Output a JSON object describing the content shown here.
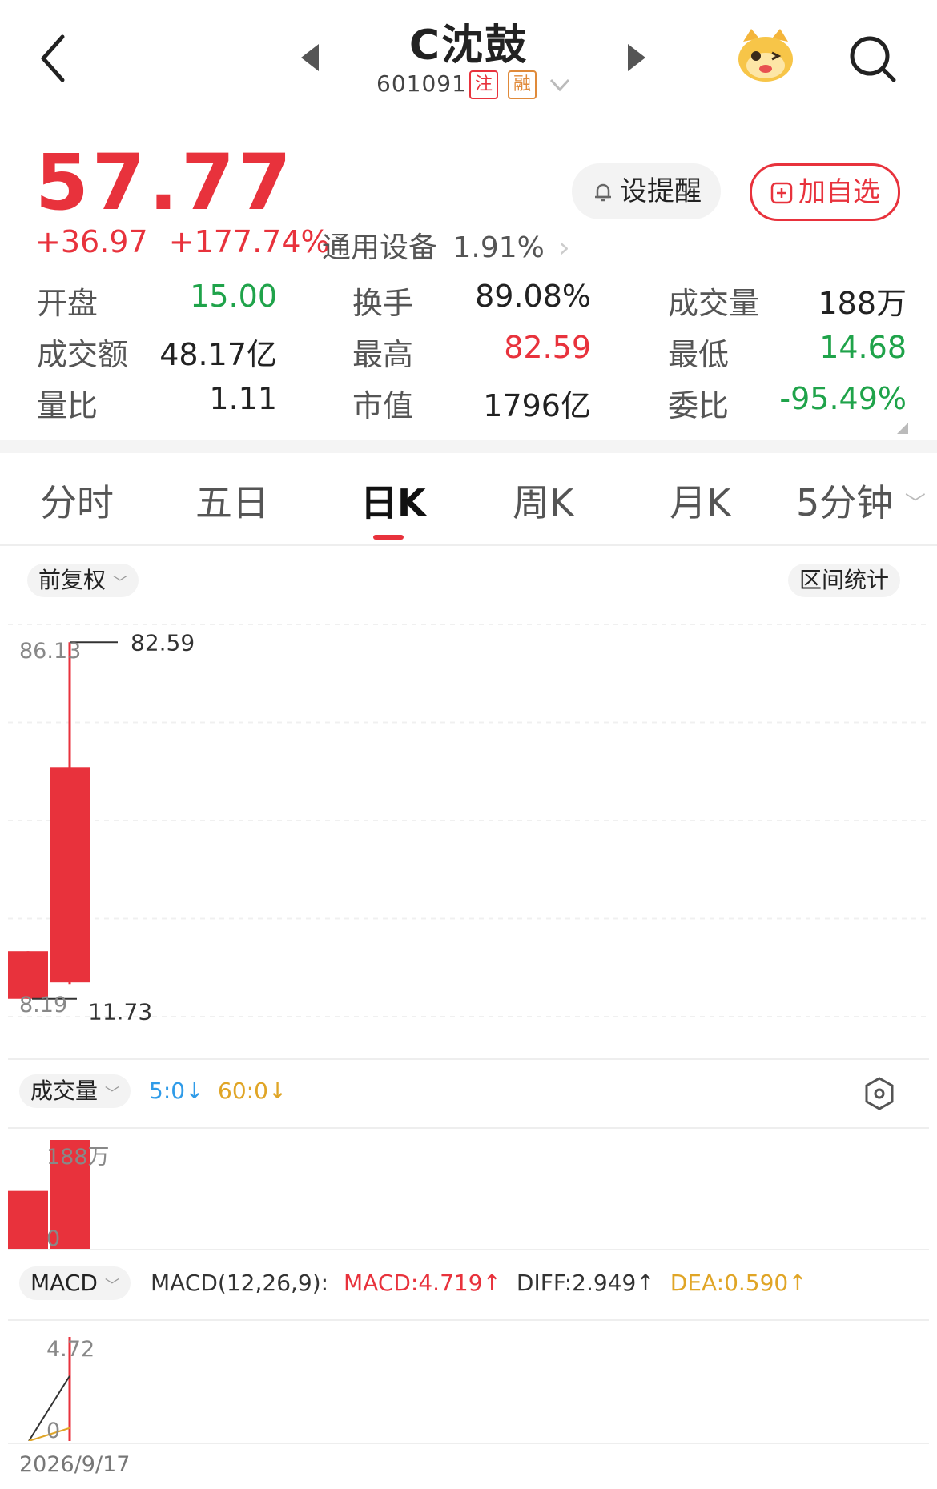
{
  "header": {
    "title": "C沈鼓",
    "code": "601091",
    "tag_margin": "注",
    "tag_finance": "融"
  },
  "quote": {
    "price": "57.77",
    "change": "+36.97",
    "change_pct": "+177.74%",
    "industry": "通用设备",
    "industry_pct": "1.91%",
    "alert_label": "设提醒",
    "add_label": "加自选"
  },
  "stats": [
    {
      "label": "开盘",
      "value": "15.00",
      "color": "green"
    },
    {
      "label": "换手",
      "value": "89.08%",
      "color": "dark"
    },
    {
      "label": "成交量",
      "value": "188万",
      "color": "dark"
    },
    {
      "label": "成交额",
      "value": "48.17亿",
      "color": "dark"
    },
    {
      "label": "最高",
      "value": "82.59",
      "color": "red"
    },
    {
      "label": "最低",
      "value": "14.68",
      "color": "green"
    },
    {
      "label": "量比",
      "value": "1.11",
      "color": "dark"
    },
    {
      "label": "市值",
      "value": "1796亿",
      "color": "dark"
    },
    {
      "label": "委比",
      "value": "-95.49%",
      "color": "green"
    }
  ],
  "tabs": [
    "分时",
    "五日",
    "日K",
    "周K",
    "月K",
    "5分钟"
  ],
  "active_tab": "日K",
  "chart_controls": {
    "adjust": "前复权",
    "range_stats": "区间统计"
  },
  "volume_panel": {
    "label": "成交量",
    "ma5": "5:0↓",
    "ma60": "60:0↓",
    "top": "188万",
    "bottom": "0"
  },
  "macd_panel": {
    "label": "MACD",
    "params": "MACD(12,26,9):",
    "macd": "MACD:4.719↑",
    "diff": "DIFF:2.949↑",
    "dea": "DEA:0.590↑",
    "top": "4.72",
    "bottom": "0"
  },
  "date_label": "2026/9/17",
  "colors": {
    "up": "#e8323c",
    "down": "#1fa34a",
    "ma5": "#2f9be8",
    "ma60": "#e0a526"
  },
  "chart_data": {
    "type": "candlestick",
    "price_axis": {
      "top": "86.13",
      "bottom": "8.19",
      "ylim": [
        8.19,
        86.13
      ]
    },
    "high_label": "82.59",
    "low_label": "11.73",
    "candles": [
      {
        "open": 11.73,
        "close": 21.2,
        "high": 21.2,
        "low": 11.73
      },
      {
        "open": 15.0,
        "close": 57.77,
        "high": 82.59,
        "low": 14.68
      }
    ],
    "volume": {
      "ylim": [
        0,
        188
      ],
      "values": [
        100,
        188
      ]
    },
    "macd": {
      "ylim": [
        0,
        4.72
      ],
      "diff": [
        0,
        2.949
      ],
      "dea": [
        0,
        0.59
      ],
      "hist": [
        0,
        4.719
      ]
    }
  }
}
